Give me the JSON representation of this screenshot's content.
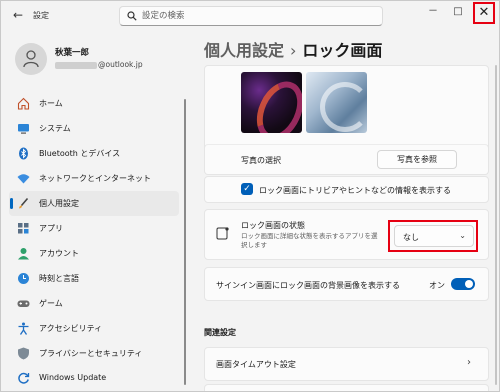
{
  "app": {
    "title": "設定"
  },
  "search": {
    "placeholder": "設定の検索"
  },
  "window_controls": {
    "minimize": "－",
    "maximize": "□",
    "close": "✕"
  },
  "user": {
    "name": "秋葉一郎",
    "email_suffix": "@outlook.jp"
  },
  "nav": [
    {
      "label": "ホーム",
      "icon": "home-icon"
    },
    {
      "label": "システム",
      "icon": "system-icon"
    },
    {
      "label": "Bluetooth とデバイス",
      "icon": "bluetooth-icon"
    },
    {
      "label": "ネットワークとインターネット",
      "icon": "network-icon"
    },
    {
      "label": "個人用設定",
      "icon": "brush-icon",
      "active": true
    },
    {
      "label": "アプリ",
      "icon": "apps-icon"
    },
    {
      "label": "アカウント",
      "icon": "account-icon"
    },
    {
      "label": "時刻と言語",
      "icon": "time-language-icon"
    },
    {
      "label": "ゲーム",
      "icon": "game-icon"
    },
    {
      "label": "アクセシビリティ",
      "icon": "accessibility-icon"
    },
    {
      "label": "プライバシーとセキュリティ",
      "icon": "shield-icon"
    },
    {
      "label": "Windows Update",
      "icon": "windows-update-icon"
    }
  ],
  "breadcrumb": {
    "parent": "個人用設定",
    "separator": "›",
    "current": "ロック画面"
  },
  "photo": {
    "label": "写真の選択",
    "browse_button": "写真を参照"
  },
  "trivia_checkbox": {
    "label": "ロック画面にトリビアやヒントなどの情報を表示する",
    "checked": true
  },
  "lock_status": {
    "title": "ロック画面の状態",
    "description_line1": "ロック画面に詳細な状態を表示するアプリを選",
    "description_line2": "択します",
    "selected": "なし"
  },
  "signin_bg": {
    "label": "サインイン画面にロック画面の背景画像を表示する",
    "state": "オン",
    "on": true
  },
  "related": {
    "title": "関連設定",
    "timeout_label": "画面タイムアウト設定"
  },
  "colors": {
    "accent": "#005fb8",
    "highlight": "#e60012"
  }
}
